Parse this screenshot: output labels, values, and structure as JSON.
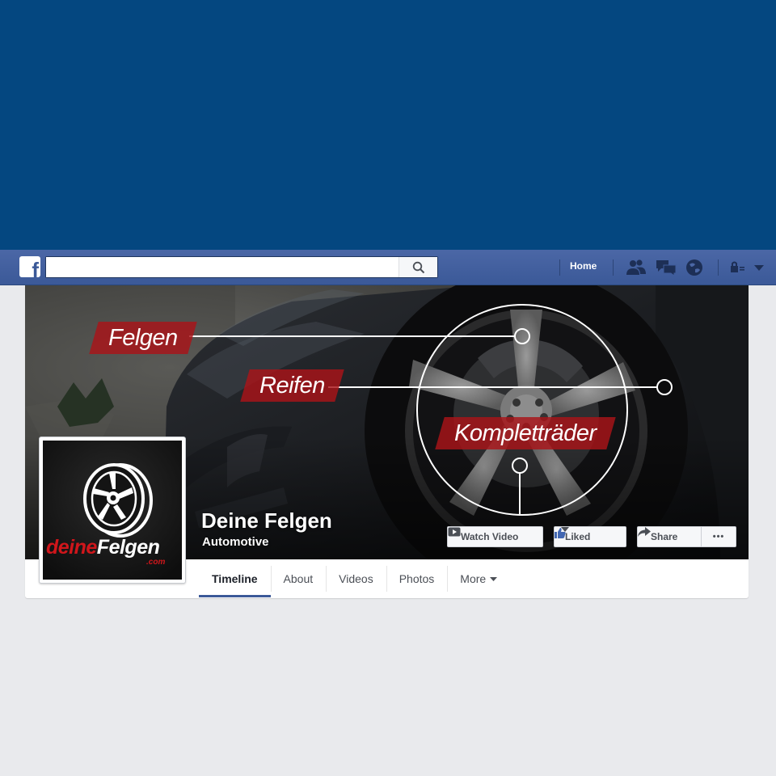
{
  "topbar": {
    "logo_glyph": "f",
    "search_placeholder": "",
    "home_label": "Home",
    "icons": [
      "friends-icon",
      "messages-icon",
      "notifications-globe-icon",
      "privacy-lock-icon",
      "account-menu-caret-icon"
    ]
  },
  "cover": {
    "tags": [
      "Felgen",
      "Reifen",
      "Kompletträder"
    ]
  },
  "page": {
    "name": "Deine Felgen",
    "category": "Automotive",
    "logo_red": "deine",
    "logo_white": "Felgen",
    "logo_com": ".com"
  },
  "actions": {
    "watch_video": "Watch Video",
    "liked": "Liked",
    "share": "Share",
    "more_dots": "•••"
  },
  "tabs": [
    "Timeline",
    "About",
    "Videos",
    "Photos",
    "More"
  ],
  "colors": {
    "top_blue": "#044780",
    "fb_blue": "#3b5998",
    "tag_red": "#aa1418",
    "background": "#e9eaed"
  }
}
